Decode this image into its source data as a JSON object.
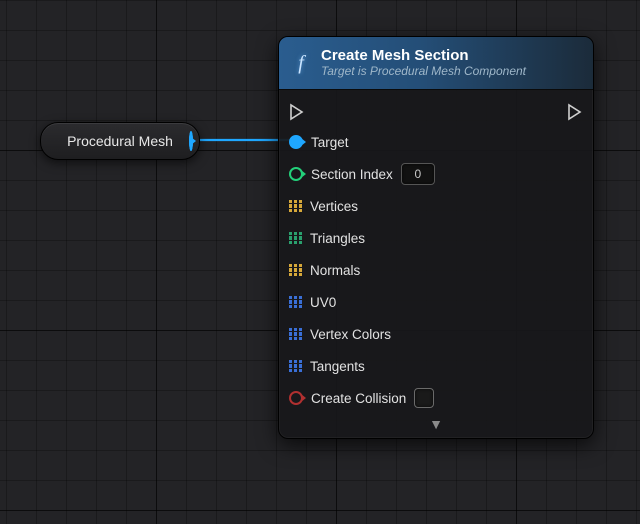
{
  "variable_node": {
    "label": "Procedural Mesh"
  },
  "func_node": {
    "icon_glyph": "f",
    "title": "Create Mesh Section",
    "subtitle": "Target is Procedural Mesh Component",
    "pins": {
      "target": "Target",
      "section_index": {
        "label": "Section Index",
        "value": "0"
      },
      "vertices": "Vertices",
      "triangles": "Triangles",
      "normals": "Normals",
      "uv0": "UV0",
      "vertex_colors": "Vertex Colors",
      "tangents": "Tangents",
      "create_collision": {
        "label": "Create Collision",
        "checked": false
      }
    },
    "expand_glyph": "▼"
  }
}
